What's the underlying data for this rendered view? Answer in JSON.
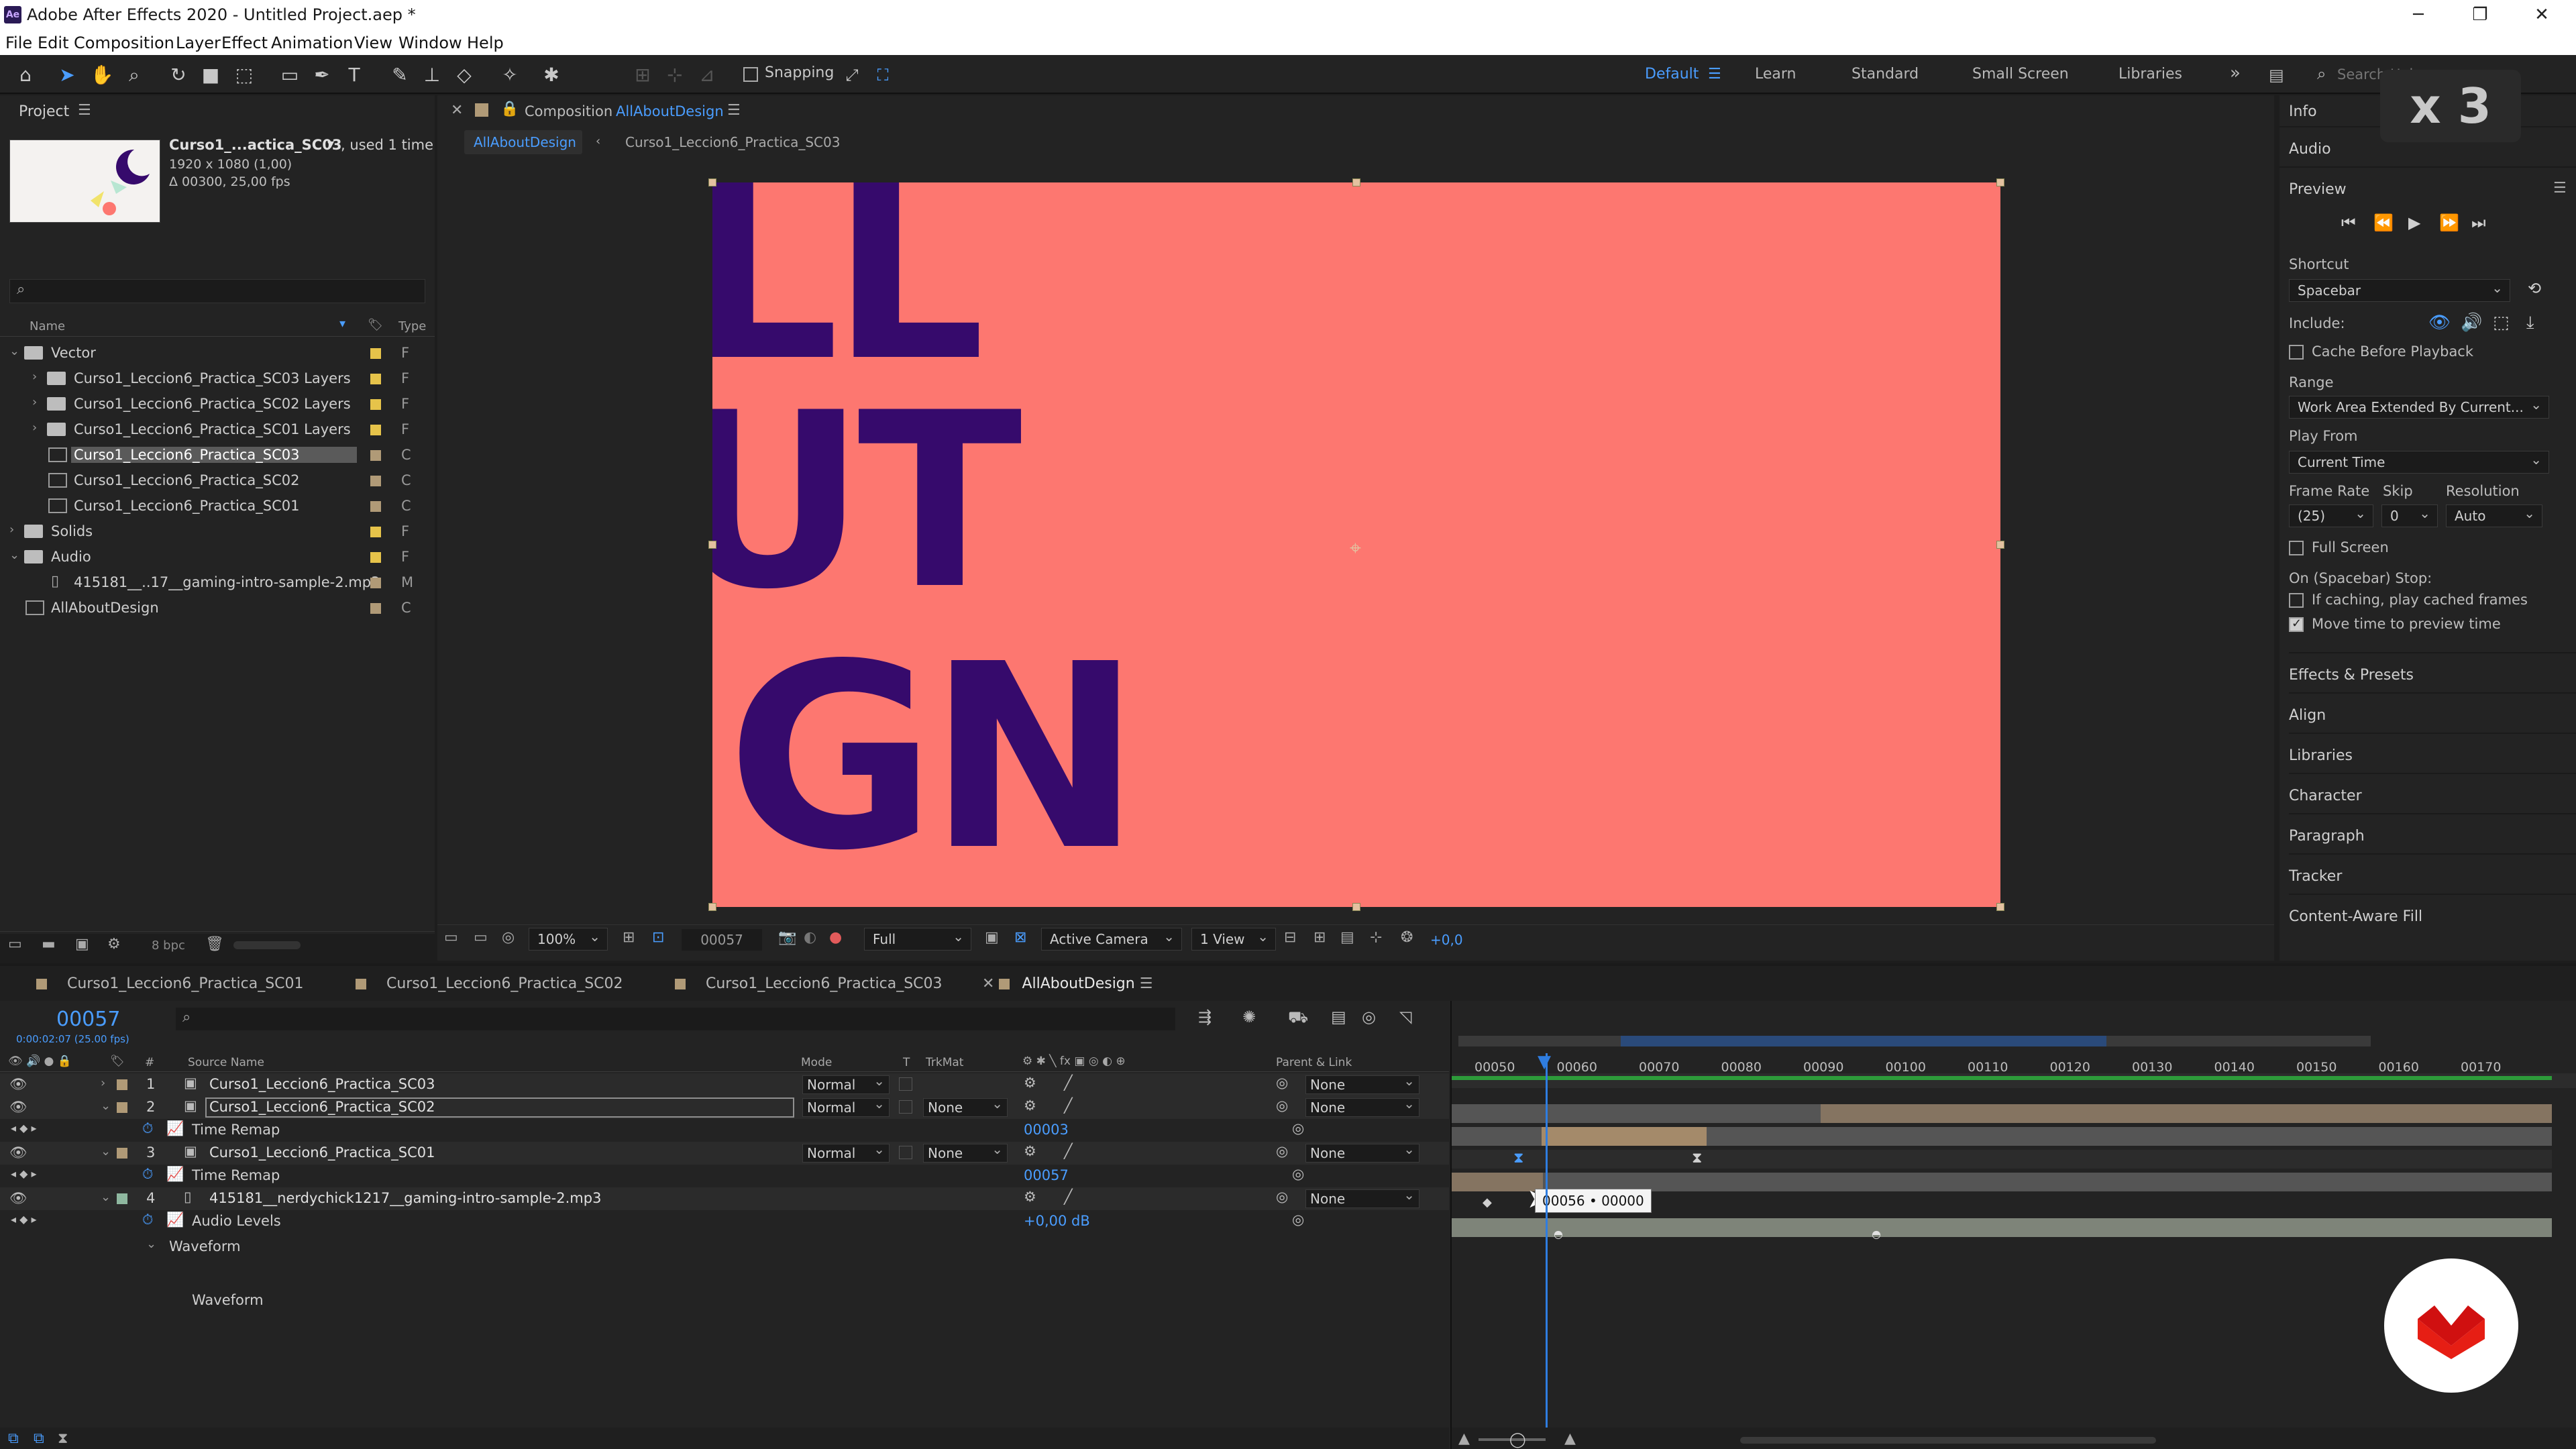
{
  "window": {
    "title": "Adobe After Effects 2020 - Untitled Project.aep *",
    "app_icon": "Ae"
  },
  "menu": [
    "File",
    "Edit",
    "Composition",
    "Layer",
    "Effect",
    "Animation",
    "View",
    "Window",
    "Help"
  ],
  "toolbar": {
    "snapping_label": "Snapping",
    "workspaces": [
      "Default",
      "Learn",
      "Standard",
      "Small Screen",
      "Libraries"
    ],
    "active_workspace": "Default",
    "search_placeholder": "Search Help"
  },
  "overlay_badge": "x 3",
  "project": {
    "title": "Project",
    "selected_name": "Curso1_...actica_SC03",
    "used": ", used 1 time",
    "dims": "1920 x 1080 (1,00)",
    "duration": "Δ 00300, 25,00 fps",
    "col_name": "Name",
    "col_type": "Type",
    "bpc": "8 bpc",
    "items": [
      {
        "name": "Vector",
        "type": "F",
        "kind": "folder",
        "indent": 0,
        "expanded": true,
        "color": "#e6c34a"
      },
      {
        "name": "Curso1_Leccion6_Practica_SC03 Layers",
        "type": "F",
        "kind": "folder",
        "indent": 1,
        "color": "#e6c34a"
      },
      {
        "name": "Curso1_Leccion6_Practica_SC02 Layers",
        "type": "F",
        "kind": "folder",
        "indent": 1,
        "color": "#e6c34a"
      },
      {
        "name": "Curso1_Leccion6_Practica_SC01 Layers",
        "type": "F",
        "kind": "folder",
        "indent": 1,
        "color": "#e6c34a"
      },
      {
        "name": "Curso1_Leccion6_Practica_SC03",
        "type": "C",
        "kind": "comp",
        "indent": 1,
        "selected": true,
        "color": "#b09a77"
      },
      {
        "name": "Curso1_Leccion6_Practica_SC02",
        "type": "C",
        "kind": "comp",
        "indent": 1,
        "color": "#b09a77"
      },
      {
        "name": "Curso1_Leccion6_Practica_SC01",
        "type": "C",
        "kind": "comp",
        "indent": 1,
        "color": "#b09a77"
      },
      {
        "name": "Solids",
        "type": "F",
        "kind": "folder",
        "indent": 0,
        "color": "#e6c34a"
      },
      {
        "name": "Audio",
        "type": "F",
        "kind": "folder",
        "indent": 0,
        "expanded": true,
        "color": "#e6c34a"
      },
      {
        "name": "415181__..17__gaming-intro-sample-2.mp3",
        "type": "M",
        "kind": "audio",
        "indent": 1,
        "color": "#b09a77"
      },
      {
        "name": "AllAboutDesign",
        "type": "C",
        "kind": "comp",
        "indent": 0,
        "color": "#b09a77"
      }
    ]
  },
  "composition": {
    "title": "Composition",
    "comp_name": "AllAboutDesign",
    "breadcrumb": [
      "AllAboutDesign",
      "Curso1_Leccion6_Practica_SC03"
    ],
    "canvas_text": [
      "LL",
      "UT",
      "IGN"
    ],
    "footer": {
      "zoom": "100%",
      "timecode": "00057",
      "resolution": "Full",
      "camera": "Active Camera",
      "view": "1 View",
      "exposure": "+0,0"
    }
  },
  "right_panel": {
    "sections_top": [
      "Info",
      "Audio"
    ],
    "preview_title": "Preview",
    "shortcut_label": "Shortcut",
    "shortcut_value": "Spacebar",
    "include_label": "Include:",
    "cache_label": "Cache Before Playback",
    "range_label": "Range",
    "range_value": "Work Area Extended By Current...",
    "play_from_label": "Play From",
    "play_from_value": "Current Time",
    "frame_rate_label": "Frame Rate",
    "frame_rate_value": "(25)",
    "skip_label": "Skip",
    "skip_value": "0",
    "resolution_label": "Resolution",
    "resolution_value": "Auto",
    "full_screen_label": "Full Screen",
    "on_stop_label": "On (Spacebar) Stop:",
    "if_caching_label": "If caching, play cached frames",
    "move_time_label": "Move time to preview time",
    "sections_bottom": [
      "Effects & Presets",
      "Align",
      "Libraries",
      "Character",
      "Paragraph",
      "Tracker",
      "Content-Aware Fill"
    ]
  },
  "timeline": {
    "tabs": [
      "Curso1_Leccion6_Practica_SC01",
      "Curso1_Leccion6_Practica_SC02",
      "Curso1_Leccion6_Practica_SC03",
      "AllAboutDesign"
    ],
    "active_tab": "AllAboutDesign",
    "current_time": "00057",
    "current_time_sub": "0:00:02:07 (25.00 fps)",
    "columns": {
      "hash": "#",
      "source": "Source Name",
      "mode": "Mode",
      "t": "T",
      "trkmat": "TrkMat",
      "parent": "Parent & Link"
    },
    "ruler": [
      "00050",
      "00060",
      "00070",
      "00080",
      "00090",
      "00100",
      "00110",
      "00120",
      "00130",
      "00140",
      "00150",
      "00160",
      "00170"
    ],
    "layers": [
      {
        "num": "1",
        "name": "Curso1_Leccion6_Practica_SC03",
        "mode": "Normal",
        "trkmat": "",
        "parent": "None"
      },
      {
        "num": "2",
        "name": "Curso1_Leccion6_Practica_SC02",
        "mode": "Normal",
        "trkmat": "None",
        "parent": "None",
        "selected": true
      },
      {
        "prop": "Time Remap",
        "value": "00003"
      },
      {
        "num": "3",
        "name": "Curso1_Leccion6_Practica_SC01",
        "mode": "Normal",
        "trkmat": "None",
        "parent": "None"
      },
      {
        "prop": "Time Remap",
        "value": "00057"
      },
      {
        "num": "4",
        "name": "415181__nerdychick1217__gaming-intro-sample-2.mp3",
        "mode": "",
        "trkmat": "",
        "parent": "None"
      },
      {
        "prop": "Audio Levels",
        "value": "+0,00 dB"
      },
      {
        "group": "Waveform"
      },
      {
        "subprop": "Waveform"
      }
    ],
    "tooltip": "00056 • 00000"
  }
}
